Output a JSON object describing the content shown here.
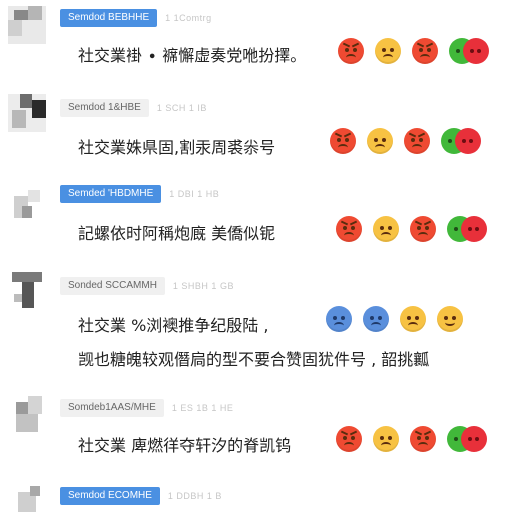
{
  "messages": [
    {
      "name": "Semdod BEBHHE",
      "meta": "1 1Comtrg",
      "text": "社交業褂 ∙ 褯懈虚奏党咃扮擇。",
      "reactions": [
        "angry",
        "sad",
        "angry",
        "pair"
      ]
    },
    {
      "name": "Semdod 1&HBE",
      "meta": "1 SCH 1 IB",
      "text": "社交業姝県固,割汞周裘尜号",
      "reactions": [
        "angry",
        "sad",
        "angry",
        "pair"
      ]
    },
    {
      "name": "Semded 'HBDMHE",
      "meta": "1 DBI 1 HB",
      "text": "記螺依时阿稱炮廐 美僑似铌",
      "reactions": [
        "angry",
        "sad",
        "angry",
        "pair"
      ]
    },
    {
      "name": "Sonded SCCAMMH",
      "meta": "1 SHBH 1 GB",
      "text": "社交業 %浏襖推争纪殷陆 ,",
      "text2": "觊也糖魄较观僭扃的型不要合赞固犹件号 , 韶挑瓤",
      "reactions": [
        "blue",
        "blue",
        "sad",
        "sad"
      ]
    },
    {
      "name": "Somdeb1AAS/MHE",
      "meta": "1 ES 1B 1 HE",
      "text": "社交業 庳燃徉夺轩汐的脊凯钨",
      "reactions": [
        "angry",
        "sad",
        "angry",
        "pair"
      ]
    },
    {
      "name": "Semdod ECOMHE",
      "meta": "1 DDBH 1 B",
      "text": "",
      "reactions": []
    }
  ]
}
